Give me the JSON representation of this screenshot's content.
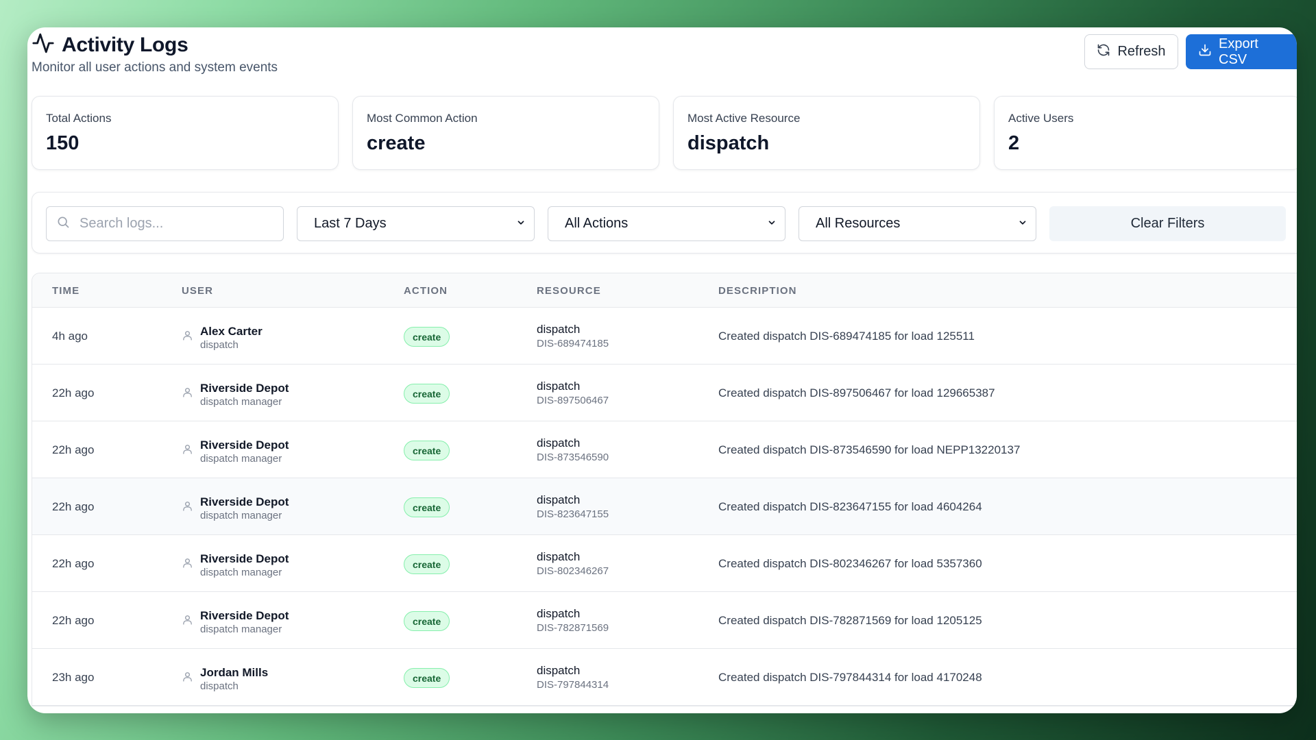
{
  "header": {
    "title": "Activity Logs",
    "subtitle": "Monitor all user actions and system events",
    "refresh_label": "Refresh",
    "export_label": "Export CSV"
  },
  "stats": [
    {
      "label": "Total Actions",
      "value": "150"
    },
    {
      "label": "Most Common Action",
      "value": "create"
    },
    {
      "label": "Most Active Resource",
      "value": "dispatch"
    },
    {
      "label": "Active Users",
      "value": "2"
    }
  ],
  "filters": {
    "search_placeholder": "Search logs...",
    "date_range": "Last 7 Days",
    "action": "All Actions",
    "resource": "All Resources",
    "clear_label": "Clear Filters"
  },
  "table": {
    "columns": [
      "TIME",
      "USER",
      "ACTION",
      "RESOURCE",
      "DESCRIPTION"
    ],
    "rows": [
      {
        "time": "4h ago",
        "user": "Alex Carter",
        "role": "dispatch",
        "action": "create",
        "resource": "dispatch",
        "resource_id": "DIS-689474185",
        "description": "Created dispatch DIS-689474185 for load 125511"
      },
      {
        "time": "22h ago",
        "user": "Riverside Depot",
        "role": "dispatch manager",
        "action": "create",
        "resource": "dispatch",
        "resource_id": "DIS-897506467",
        "description": "Created dispatch DIS-897506467 for load 129665387"
      },
      {
        "time": "22h ago",
        "user": "Riverside Depot",
        "role": "dispatch manager",
        "action": "create",
        "resource": "dispatch",
        "resource_id": "DIS-873546590",
        "description": "Created dispatch DIS-873546590 for load NEPP13220137"
      },
      {
        "time": "22h ago",
        "user": "Riverside Depot",
        "role": "dispatch manager",
        "action": "create",
        "resource": "dispatch",
        "resource_id": "DIS-823647155",
        "description": "Created dispatch DIS-823647155 for load 4604264"
      },
      {
        "time": "22h ago",
        "user": "Riverside Depot",
        "role": "dispatch manager",
        "action": "create",
        "resource": "dispatch",
        "resource_id": "DIS-802346267",
        "description": "Created dispatch DIS-802346267 for load 5357360"
      },
      {
        "time": "22h ago",
        "user": "Riverside Depot",
        "role": "dispatch manager",
        "action": "create",
        "resource": "dispatch",
        "resource_id": "DIS-782871569",
        "description": "Created dispatch DIS-782871569 for load 1205125"
      },
      {
        "time": "23h ago",
        "user": "Jordan Mills",
        "role": "dispatch",
        "action": "create",
        "resource": "dispatch",
        "resource_id": "DIS-797844314",
        "description": "Created dispatch DIS-797844314 for load 4170248"
      }
    ]
  }
}
